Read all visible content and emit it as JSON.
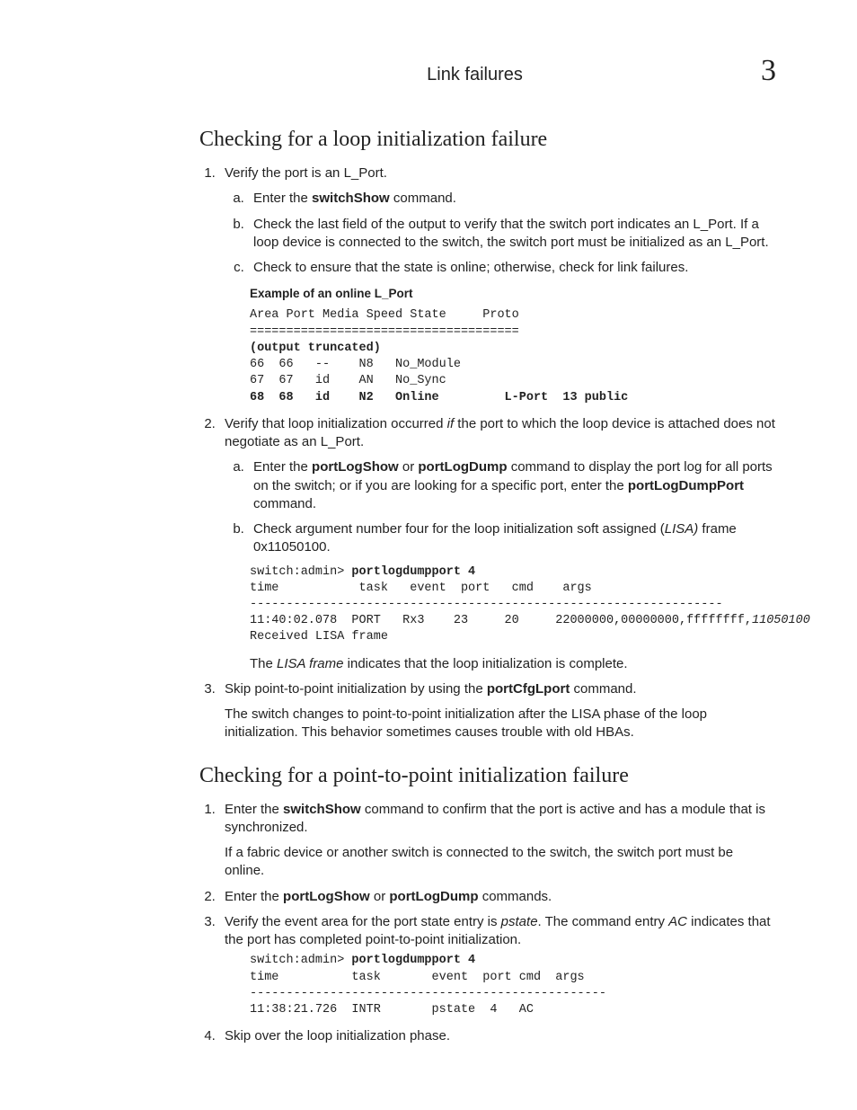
{
  "header": {
    "running": "Link failures",
    "chapter": "3"
  },
  "sec1": {
    "title": "Checking for a loop initialization failure",
    "li1": "Verify the port is an L_Port.",
    "li1a_pre": "Enter the ",
    "li1a_cmd": "switchShow",
    "li1a_post": " command.",
    "li1b": "Check the last field of the output to verify that the switch port indicates an L_Port. If a loop device is connected to the switch, the switch port must be initialized as an L_Port.",
    "li1c": "Check to ensure that the state is online; otherwise, check for link failures.",
    "example1_label": "Example  of an online L_Port",
    "code1_l1": "Area Port Media Speed State     Proto",
    "code1_l2": "=====================================",
    "code1_l3": "(output truncated)",
    "code1_l4": "66  66   --    N8   No_Module",
    "code1_l5": "67  67   id    AN   No_Sync",
    "code1_l6": "68  68   id    N2   Online         L-Port  13 public",
    "li2_pre": "Verify that loop initialization occurred ",
    "li2_if": "if",
    "li2_post": " the port to which the loop device is attached does not negotiate as an L_Port.",
    "li2a_t1": "Enter the ",
    "li2a_c1": "portLogShow",
    "li2a_t2": " or ",
    "li2a_c2": "portLogDump",
    "li2a_t3": " command to display the port log for all ports on the switch; or if you are looking for a specific port, enter the ",
    "li2a_c3": "portLogDumpPort",
    "li2a_t4": " command.",
    "li2b_t1": "Check argument number four for the loop initialization soft assigned (",
    "li2b_i": "LISA)",
    "li2b_t2": " frame 0x11050100.",
    "code2_prompt": "switch:admin> ",
    "code2_cmd": "portlogdumpport 4",
    "code2_hdr": "time           task   event  port   cmd    args",
    "code2_dash": "-----------------------------------------------------------------",
    "code2_row_a": "11:40:02.078  PORT   Rx3    23     20     22000000,00000000,ffffffff,",
    "code2_row_b": "11050100",
    "code2_note": "Received LISA frame",
    "li2_after_t1": "The ",
    "li2_after_i": "LISA frame",
    "li2_after_t2": " indicates that the loop initialization is complete.",
    "li3_t1": "Skip point-to-point initialization by using the ",
    "li3_c1": "portCfgLport",
    "li3_t2": " command.",
    "li3_after": "The switch changes to point-to-point initialization after the LISA phase of the loop initialization. This behavior sometimes causes trouble with old HBAs."
  },
  "sec2": {
    "title": "Checking for a point-to-point initialization failure",
    "li1_t1": "Enter the ",
    "li1_c1": "switchShow",
    "li1_t2": " command to confirm that the port is active and has a module that is synchronized.",
    "li1_after": "If a fabric device or another switch is connected to the switch, the switch port must be online.",
    "li2_t1": "Enter the ",
    "li2_c1": "portLogShow",
    "li2_t2": " or ",
    "li2_c2": "portLogDump",
    "li2_t3": " commands.",
    "li3_t1": "Verify the event area for the port state entry is ",
    "li3_i1": "pstate",
    "li3_t2": ". The command entry ",
    "li3_i2": "AC",
    "li3_t3": " indicates that the port has completed point-to-point initialization.",
    "code_prompt": "switch:admin> ",
    "code_cmd": "portlogdumpport 4",
    "code_hdr": "time          task       event  port cmd  args",
    "code_dash": "-------------------------------------------------",
    "code_row": "11:38:21.726  INTR       pstate  4   AC",
    "li4": "Skip over the loop initialization phase."
  }
}
